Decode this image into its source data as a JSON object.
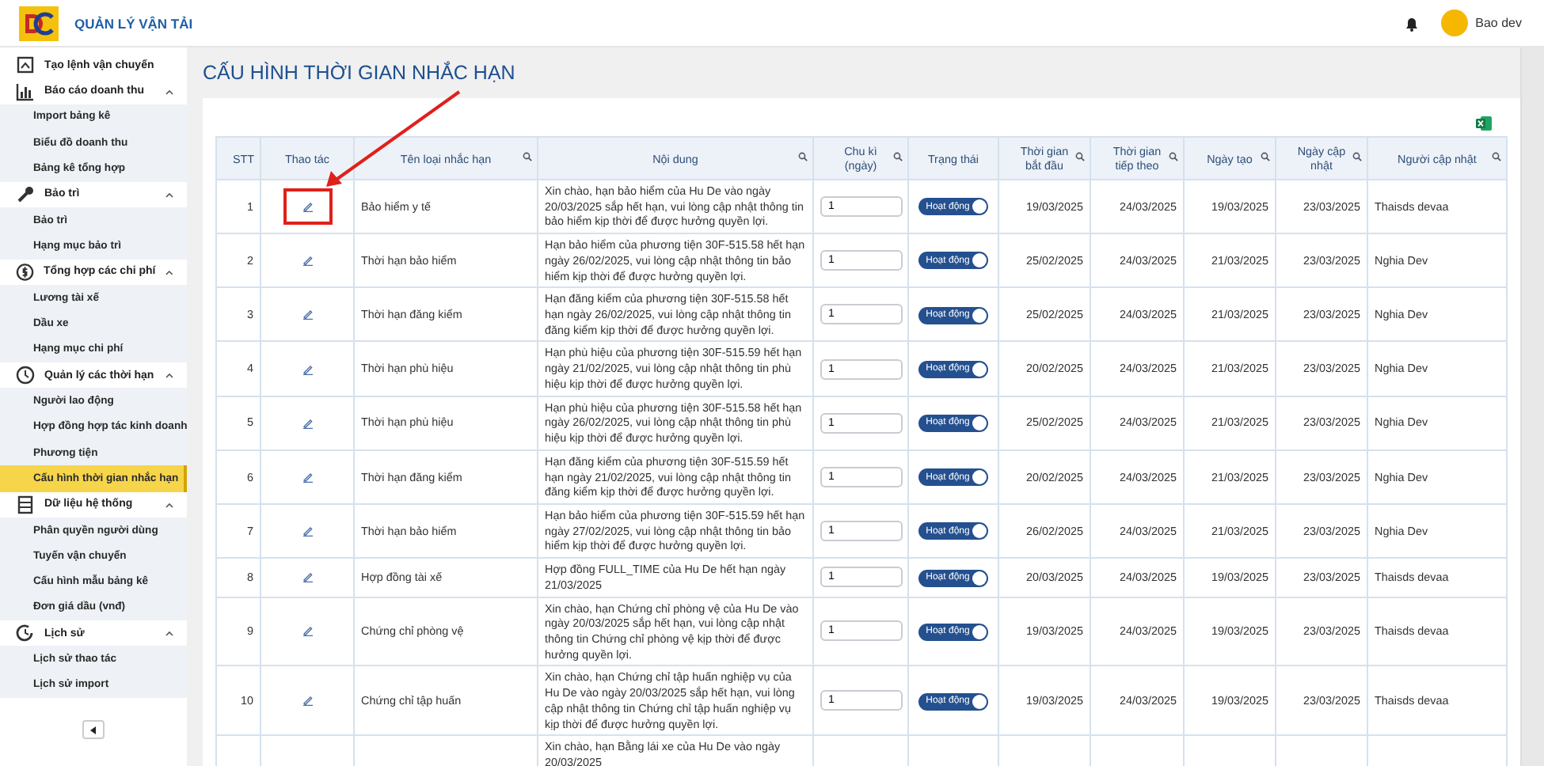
{
  "header": {
    "app_title": "QUẢN LÝ VẬN TẢI",
    "user_name": "Bao dev"
  },
  "sidebar": {
    "items": [
      {
        "label": "Tạo lệnh vận chuyển"
      },
      {
        "label": "Báo cáo doanh thu",
        "expanded": true,
        "children": [
          {
            "label": "Import bảng kê",
            "selected": false
          },
          {
            "label": "Biểu đồ doanh thu",
            "selected": false
          },
          {
            "label": "Bảng kê tổng hợp",
            "selected": false
          }
        ]
      },
      {
        "label": "Bảo trì",
        "expanded": true,
        "children": [
          {
            "label": "Bảo trì",
            "selected": false
          },
          {
            "label": "Hạng mục bảo trì",
            "selected": false
          }
        ]
      },
      {
        "label": "Tổng hợp các chi phí",
        "expanded": true,
        "children": [
          {
            "label": "Lương tài xế",
            "selected": false
          },
          {
            "label": "Dầu xe",
            "selected": false
          },
          {
            "label": "Hạng mục chi phí",
            "selected": false
          }
        ]
      },
      {
        "label": "Quản lý các thời hạn",
        "expanded": true,
        "children": [
          {
            "label": "Người lao động",
            "selected": false
          },
          {
            "label": "Hợp đồng hợp tác kinh doanh",
            "selected": false
          },
          {
            "label": "Phương tiện",
            "selected": false
          },
          {
            "label": "Cấu hình thời gian nhắc hạn",
            "selected": true
          }
        ]
      },
      {
        "label": "Dữ liệu hệ thống",
        "expanded": true,
        "children": [
          {
            "label": "Phân quyền người dùng",
            "selected": false
          },
          {
            "label": "Tuyến vận chuyển",
            "selected": false
          },
          {
            "label": "Cấu hình mẫu bảng kê",
            "selected": false
          },
          {
            "label": "Đơn giá dầu (vnđ)",
            "selected": false
          }
        ]
      },
      {
        "label": "Lịch sử",
        "expanded": true,
        "children": [
          {
            "label": "Lịch sử thao tác",
            "selected": false
          },
          {
            "label": "Lịch sử import",
            "selected": false
          }
        ]
      }
    ]
  },
  "page_title": "CẤU HÌNH THỜI GIAN NHẮC HẠN",
  "table": {
    "columns": [
      {
        "label": "STT",
        "searchable": false
      },
      {
        "label": "Thao tác",
        "searchable": false
      },
      {
        "label": "Tên loại nhắc hạn",
        "searchable": true
      },
      {
        "label": "Nội dung",
        "searchable": true
      },
      {
        "label": "Chu kì (ngày)",
        "searchable": true
      },
      {
        "label": "Trạng thái",
        "searchable": false
      },
      {
        "label": "Thời gian bắt đầu",
        "searchable": true
      },
      {
        "label": "Thời gian tiếp theo",
        "searchable": true
      },
      {
        "label": "Ngày tạo",
        "searchable": true
      },
      {
        "label": "Ngày cập nhật",
        "searchable": true
      },
      {
        "label": "Người cập nhật",
        "searchable": true
      }
    ],
    "rows": [
      {
        "stt": "1",
        "highlighted": true,
        "type": "Bảo hiểm y tế",
        "content": "Xin chào, hạn bảo hiểm của Hu De vào ngày 20/03/2025 sắp hết hạn, vui lòng cập nhật thông tin bảo hiểm kịp thời để được hưởng quyền lợi.",
        "cycle": "1",
        "status": {
          "label": "Hoạt động",
          "on": true
        },
        "start": "19/03/2025",
        "next": "24/03/2025",
        "created": "19/03/2025",
        "updated": "23/03/2025",
        "updated_by": "Thaisds devaa"
      },
      {
        "stt": "2",
        "highlighted": false,
        "type": "Thời hạn bảo hiểm",
        "content": "Hạn bảo hiểm của phương tiện 30F-515.58 hết hạn ngày 26/02/2025, vui lòng cập nhật thông tin bảo hiểm kịp thời để được hưởng quyền lợi.",
        "cycle": "1",
        "status": {
          "label": "Hoạt động",
          "on": true
        },
        "start": "25/02/2025",
        "next": "24/03/2025",
        "created": "21/03/2025",
        "updated": "23/03/2025",
        "updated_by": "Nghia Dev"
      },
      {
        "stt": "3",
        "highlighted": false,
        "type": "Thời hạn đăng kiểm",
        "content": "Hạn đăng kiểm của phương tiện 30F-515.58 hết hạn ngày 26/02/2025, vui lòng cập nhật thông tin đăng kiểm kịp thời để được hưởng quyền lợi.",
        "cycle": "1",
        "status": {
          "label": "Hoạt động",
          "on": true
        },
        "start": "25/02/2025",
        "next": "24/03/2025",
        "created": "21/03/2025",
        "updated": "23/03/2025",
        "updated_by": "Nghia Dev"
      },
      {
        "stt": "4",
        "highlighted": false,
        "type": "Thời hạn phù hiệu",
        "content": "Hạn phù hiệu của phương tiện 30F-515.59 hết hạn ngày 21/02/2025, vui lòng cập nhật thông tin phù hiệu kịp thời để được hưởng quyền lợi.",
        "cycle": "1",
        "status": {
          "label": "Hoạt động",
          "on": true
        },
        "start": "20/02/2025",
        "next": "24/03/2025",
        "created": "21/03/2025",
        "updated": "23/03/2025",
        "updated_by": "Nghia Dev"
      },
      {
        "stt": "5",
        "highlighted": false,
        "type": "Thời hạn phù hiệu",
        "content": "Hạn phù hiệu của phương tiện 30F-515.58 hết hạn ngày 26/02/2025, vui lòng cập nhật thông tin phù hiệu kịp thời để được hưởng quyền lợi.",
        "cycle": "1",
        "status": {
          "label": "Hoạt động",
          "on": true
        },
        "start": "25/02/2025",
        "next": "24/03/2025",
        "created": "21/03/2025",
        "updated": "23/03/2025",
        "updated_by": "Nghia Dev"
      },
      {
        "stt": "6",
        "highlighted": false,
        "type": "Thời hạn đăng kiểm",
        "content": "Hạn đăng kiểm của phương tiện 30F-515.59 hết hạn ngày 21/02/2025, vui lòng cập nhật thông tin đăng kiểm kịp thời để được hưởng quyền lợi.",
        "cycle": "1",
        "status": {
          "label": "Hoạt động",
          "on": true
        },
        "start": "20/02/2025",
        "next": "24/03/2025",
        "created": "21/03/2025",
        "updated": "23/03/2025",
        "updated_by": "Nghia Dev"
      },
      {
        "stt": "7",
        "highlighted": false,
        "type": "Thời hạn bảo hiểm",
        "content": "Hạn bảo hiểm của phương tiện 30F-515.59 hết hạn ngày 27/02/2025, vui lòng cập nhật thông tin bảo hiểm kịp thời để được hưởng quyền lợi.",
        "cycle": "1",
        "status": {
          "label": "Hoạt động",
          "on": true
        },
        "start": "26/02/2025",
        "next": "24/03/2025",
        "created": "21/03/2025",
        "updated": "23/03/2025",
        "updated_by": "Nghia Dev"
      },
      {
        "stt": "8",
        "highlighted": false,
        "type": "Hợp đồng tài xế",
        "content": "Hợp đồng FULL_TIME của Hu De hết hạn ngày 21/03/2025",
        "cycle": "1",
        "status": {
          "label": "Hoạt động",
          "on": true
        },
        "start": "20/03/2025",
        "next": "24/03/2025",
        "created": "19/03/2025",
        "updated": "23/03/2025",
        "updated_by": "Thaisds devaa"
      },
      {
        "stt": "9",
        "highlighted": false,
        "type": "Chứng chỉ phòng vệ",
        "content": "Xin chào, hạn Chứng chỉ phòng vệ của Hu De vào ngày 20/03/2025 sắp hết hạn, vui lòng cập nhật thông tin Chứng chỉ phòng vệ kịp thời để được hưởng quyền lợi.",
        "cycle": "1",
        "status": {
          "label": "Hoạt động",
          "on": true
        },
        "start": "19/03/2025",
        "next": "24/03/2025",
        "created": "19/03/2025",
        "updated": "23/03/2025",
        "updated_by": "Thaisds devaa"
      },
      {
        "stt": "10",
        "highlighted": false,
        "type": "Chứng chỉ tập huấn",
        "content": "Xin chào, hạn Chứng chỉ tập huấn nghiệp vụ của Hu De vào ngày 20/03/2025 sắp hết hạn, vui lòng cập nhật thông tin Chứng chỉ tập huấn nghiệp vụ kịp thời để được hưởng quyền lợi.",
        "cycle": "1",
        "status": {
          "label": "Hoạt động",
          "on": true
        },
        "start": "19/03/2025",
        "next": "24/03/2025",
        "created": "19/03/2025",
        "updated": "23/03/2025",
        "updated_by": "Thaisds devaa"
      },
      {
        "content": "Xin chào, hạn Bằng lái xe của Hu De vào ngày 20/03/2025"
      }
    ]
  }
}
